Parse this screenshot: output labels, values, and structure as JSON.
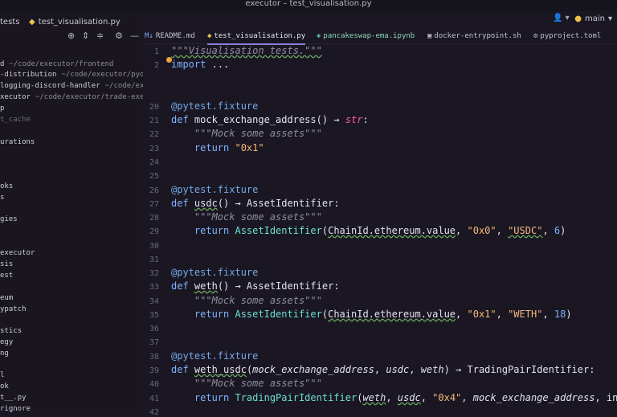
{
  "window": {
    "title": "executor – test_visualisation.py"
  },
  "header": {
    "project_label": "tests",
    "active_file": "test_visualisation.py",
    "branch": "main",
    "user_icon": "person-icon"
  },
  "sidebar": {
    "items": [
      {
        "name": "d",
        "path": "~/code/executor/frontend"
      },
      {
        "name": "-distribution",
        "path": "~/code/executor/pyodic"
      },
      {
        "name": "logging-discord-handler",
        "path": "~/code/execu"
      },
      {
        "name": "xecutor",
        "path": "~/code/executor/trade-execut"
      },
      {
        "name": "p",
        "path": ""
      },
      {
        "name": "t_cache",
        "path": ""
      },
      {
        "name": "urations",
        "path": ""
      },
      {
        "name": "oks",
        "path": ""
      },
      {
        "name": "s",
        "path": ""
      },
      {
        "name": "gies",
        "path": ""
      },
      {
        "name": "executor",
        "path": ""
      },
      {
        "name": "sis",
        "path": ""
      },
      {
        "name": "est",
        "path": ""
      },
      {
        "name": "eum",
        "path": ""
      },
      {
        "name": "ypatch",
        "path": ""
      },
      {
        "name": "stics",
        "path": ""
      },
      {
        "name": "egy",
        "path": ""
      },
      {
        "name": "ng",
        "path": ""
      },
      {
        "name": "l",
        "path": ""
      },
      {
        "name": "ok",
        "path": ""
      },
      {
        "name": "t__.py",
        "path": ""
      },
      {
        "name": "rignore",
        "path": ""
      }
    ]
  },
  "tabs": [
    {
      "label": "README.md"
    },
    {
      "label": "test_visualisation.py"
    },
    {
      "label": "pancakeswap-ema.ipynb"
    },
    {
      "label": "docker-entrypoint.sh"
    },
    {
      "label": "pyproject.toml"
    }
  ],
  "editor": {
    "line_numbers": [
      "1",
      "2",
      "20",
      "21",
      "22",
      "23",
      "24",
      "25",
      "26",
      "27",
      "28",
      "29",
      "30",
      "31",
      "32",
      "33",
      "34",
      "35",
      "36",
      "37",
      "38",
      "39",
      "40",
      "41",
      "42"
    ],
    "code": {
      "l1": "\"\"\"Visualisation tests.\"\"\"",
      "l2a": "import",
      "l2b": " ...",
      "dec": "@pytest.fixture",
      "def": "def ",
      "f1": "mock_exchange_address",
      "f1b": "() → ",
      "f1c": "str",
      "colon": ":",
      "doc": "\"\"\"Mock some assets\"\"\"",
      "ret": "return ",
      "r1": "\"0x1\"",
      "f2": "usdc",
      "f2b": "() → AssetIdentifier:",
      "cls1": "AssetIdentifier",
      "chain": "ChainId.ethereum.value",
      "comma": ", ",
      "lp": "(",
      "rp": ")",
      "s0x0": "\"0x0\"",
      "susdc": "\"USDC\"",
      "n6": "6",
      "f3": "weth",
      "f3b": "() → AssetIdentifier:",
      "s0x1": "\"0x1\"",
      "sweth": "\"WETH\"",
      "n18": "18",
      "f4": "weth_usdc",
      "p1": "mock_exchange_address",
      "p2": "usdc",
      "p3": "weth",
      "f4b": ") → TradingPairIdentifier:",
      "cls2": "TradingPairIdentifier",
      "s0x4": "\"0x4\"",
      "tail": "inter"
    }
  }
}
